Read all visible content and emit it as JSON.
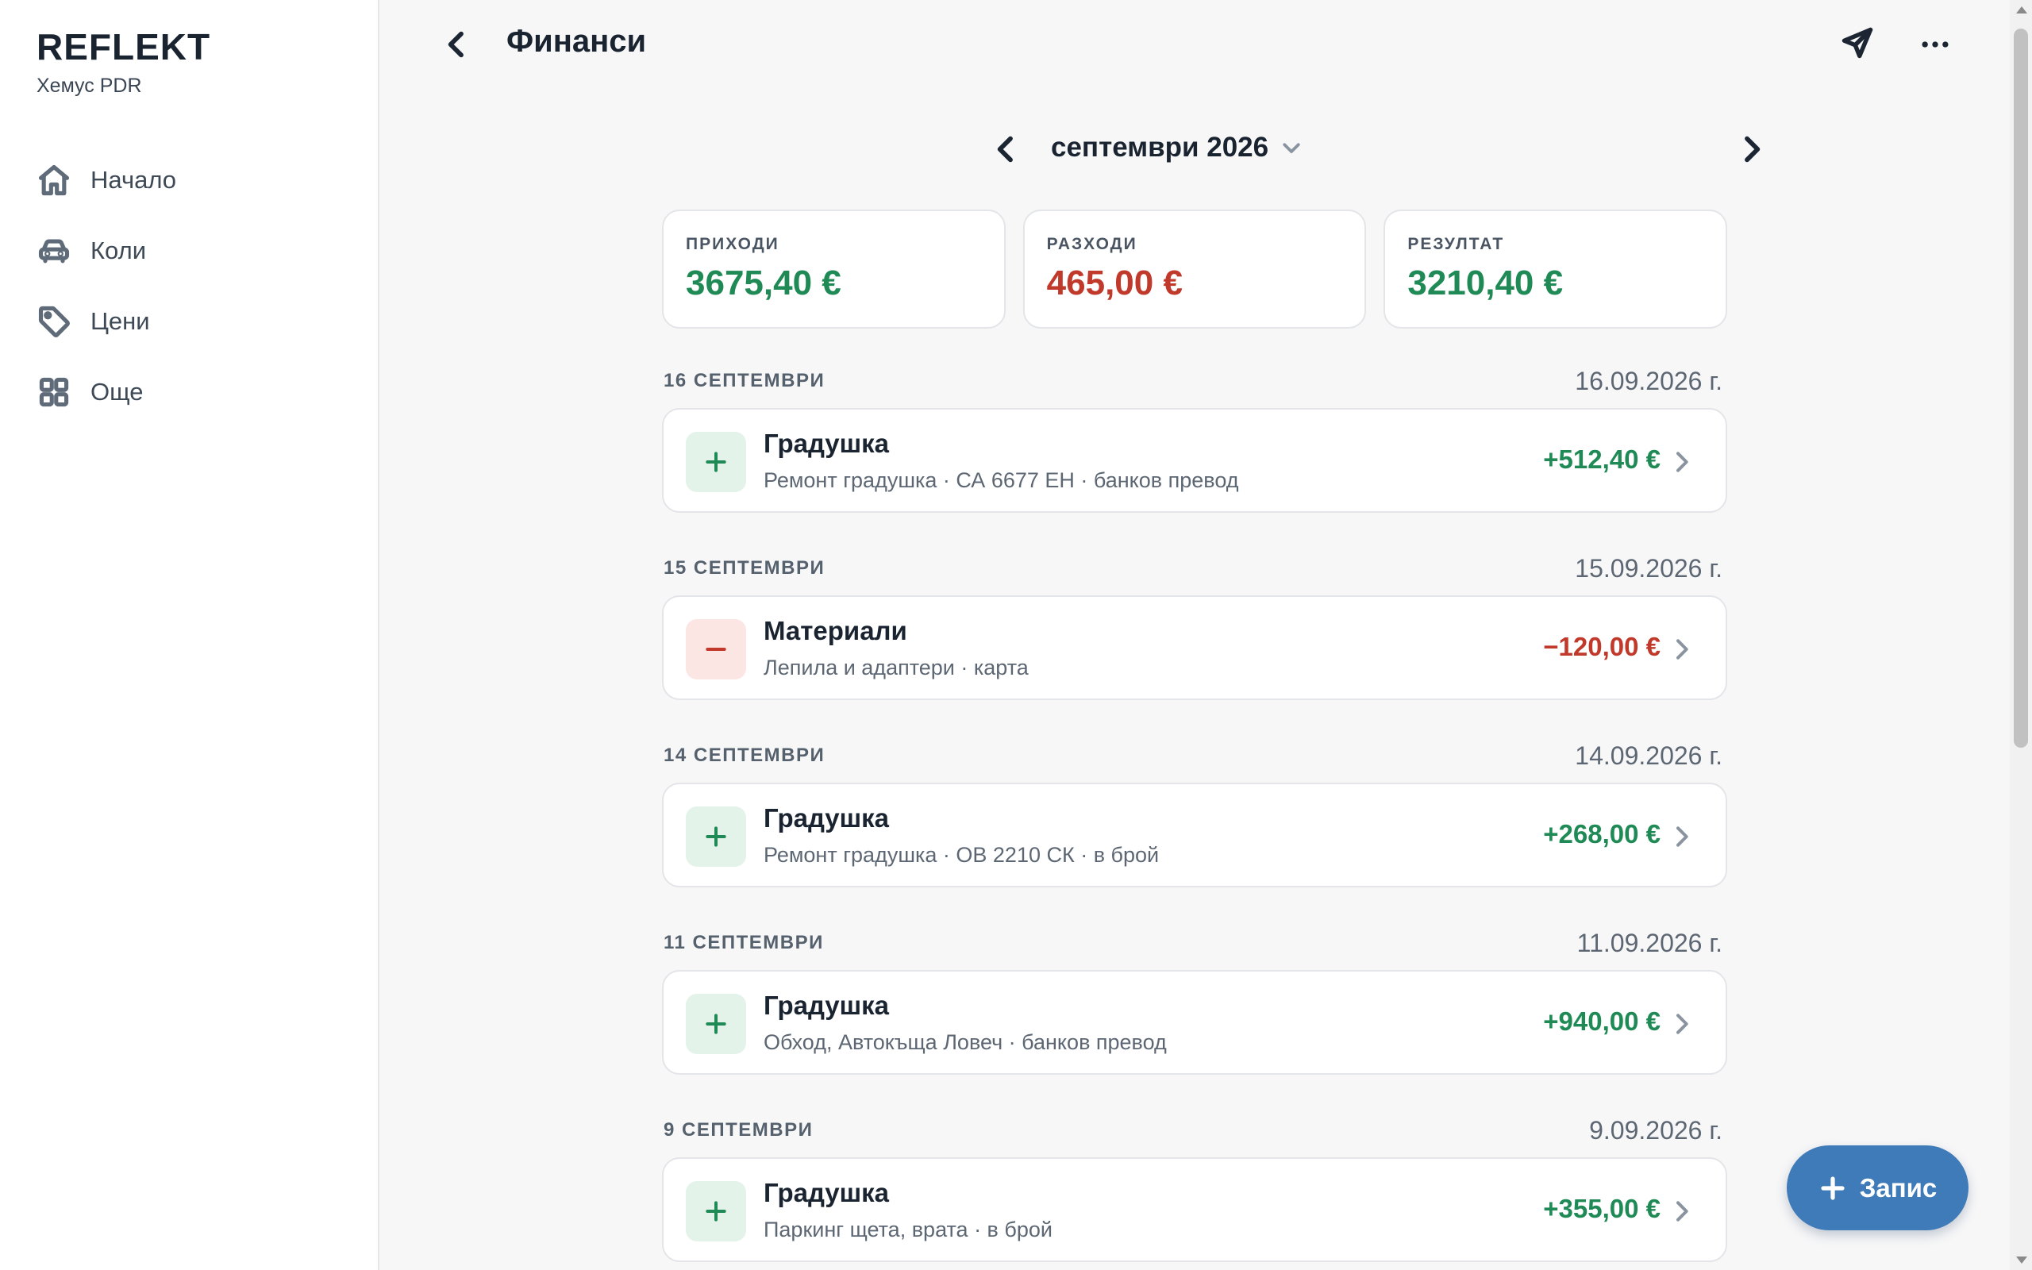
{
  "sidebar": {
    "logo": "REFLEKT",
    "workspace": "Хемус PDR",
    "items": [
      {
        "label": "Начало",
        "icon": "home-icon"
      },
      {
        "label": "Коли",
        "icon": "car-icon"
      },
      {
        "label": "Цени",
        "icon": "tag-icon"
      },
      {
        "label": "Още",
        "icon": "grid-icon"
      }
    ]
  },
  "header": {
    "title": "Финанси",
    "actions": [
      "send-icon",
      "more-icon"
    ]
  },
  "period": {
    "label": "септември 2026"
  },
  "summary": {
    "income_label": "ПРИХОДИ",
    "income_value": "3675,40 €",
    "expense_label": "РАЗХОДИ",
    "expense_value": "465,00 €",
    "result_label": "РЕЗУЛТАТ",
    "result_value": "3210,40 €"
  },
  "days": [
    {
      "label": "16 СЕПТЕМВРИ",
      "date": "16.09.2026 г.",
      "tx": {
        "type": "income",
        "title": "Градушка",
        "subtitle": "Ремонт градушка · СА 6677 ЕН · банков превод",
        "amount": "+512,40 €"
      }
    },
    {
      "label": "15 СЕПТЕМВРИ",
      "date": "15.09.2026 г.",
      "tx": {
        "type": "expense",
        "title": "Материали",
        "subtitle": "Лепила и адаптери · карта",
        "amount": "−120,00 €"
      }
    },
    {
      "label": "14 СЕПТЕМВРИ",
      "date": "14.09.2026 г.",
      "tx": {
        "type": "income",
        "title": "Градушка",
        "subtitle": "Ремонт градушка · ОВ 2210 СК · в брой",
        "amount": "+268,00 €"
      }
    },
    {
      "label": "11 СЕПТЕМВРИ",
      "date": "11.09.2026 г.",
      "tx": {
        "type": "income",
        "title": "Градушка",
        "subtitle": "Обход, Автокъща Ловеч · банков превод",
        "amount": "+940,00 €"
      }
    },
    {
      "label": "9 СЕПТЕМВРИ",
      "date": "9.09.2026 г.",
      "tx": {
        "type": "income",
        "title": "Градушка",
        "subtitle": "Паркинг щета, врата · в брой",
        "amount": "+355,00 €"
      }
    }
  ],
  "fab": {
    "label": "Запис"
  },
  "colors": {
    "income": "#1f8a55",
    "expense": "#c0392b",
    "accent": "#3e7bb8"
  }
}
